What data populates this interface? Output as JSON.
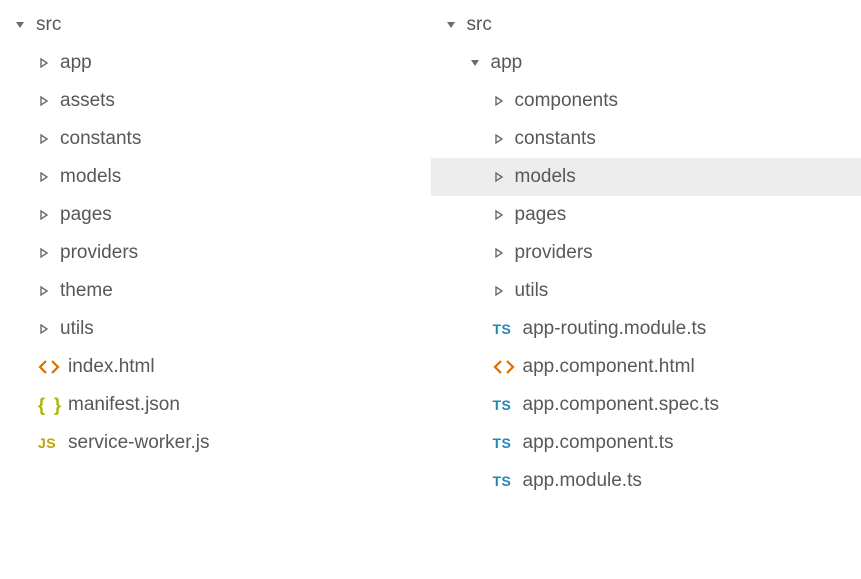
{
  "left": {
    "items": [
      {
        "label": "src",
        "type": "folder",
        "expanded": true,
        "depth": 0,
        "selected": false
      },
      {
        "label": "app",
        "type": "folder",
        "expanded": false,
        "depth": 1,
        "selected": false
      },
      {
        "label": "assets",
        "type": "folder",
        "expanded": false,
        "depth": 1,
        "selected": false
      },
      {
        "label": "constants",
        "type": "folder",
        "expanded": false,
        "depth": 1,
        "selected": false
      },
      {
        "label": "models",
        "type": "folder",
        "expanded": false,
        "depth": 1,
        "selected": false
      },
      {
        "label": "pages",
        "type": "folder",
        "expanded": false,
        "depth": 1,
        "selected": false
      },
      {
        "label": "providers",
        "type": "folder",
        "expanded": false,
        "depth": 1,
        "selected": false
      },
      {
        "label": "theme",
        "type": "folder",
        "expanded": false,
        "depth": 1,
        "selected": false
      },
      {
        "label": "utils",
        "type": "folder",
        "expanded": false,
        "depth": 1,
        "selected": false
      },
      {
        "label": "index.html",
        "type": "file",
        "icon": "html",
        "depth": 1,
        "selected": false
      },
      {
        "label": "manifest.json",
        "type": "file",
        "icon": "json",
        "depth": 1,
        "selected": false
      },
      {
        "label": "service-worker.js",
        "type": "file",
        "icon": "js",
        "depth": 1,
        "selected": false
      }
    ]
  },
  "right": {
    "items": [
      {
        "label": "src",
        "type": "folder",
        "expanded": true,
        "depth": 0,
        "selected": false
      },
      {
        "label": "app",
        "type": "folder",
        "expanded": true,
        "depth": 1,
        "selected": false
      },
      {
        "label": "components",
        "type": "folder",
        "expanded": false,
        "depth": 2,
        "selected": false
      },
      {
        "label": "constants",
        "type": "folder",
        "expanded": false,
        "depth": 2,
        "selected": false
      },
      {
        "label": "models",
        "type": "folder",
        "expanded": false,
        "depth": 2,
        "selected": true
      },
      {
        "label": "pages",
        "type": "folder",
        "expanded": false,
        "depth": 2,
        "selected": false
      },
      {
        "label": "providers",
        "type": "folder",
        "expanded": false,
        "depth": 2,
        "selected": false
      },
      {
        "label": "utils",
        "type": "folder",
        "expanded": false,
        "depth": 2,
        "selected": false
      },
      {
        "label": "app-routing.module.ts",
        "type": "file",
        "icon": "ts",
        "depth": 2,
        "selected": false
      },
      {
        "label": "app.component.html",
        "type": "file",
        "icon": "html",
        "depth": 2,
        "selected": false
      },
      {
        "label": "app.component.spec.ts",
        "type": "file",
        "icon": "ts",
        "depth": 2,
        "selected": false
      },
      {
        "label": "app.component.ts",
        "type": "file",
        "icon": "ts",
        "depth": 2,
        "selected": false
      },
      {
        "label": "app.module.ts",
        "type": "file",
        "icon": "ts",
        "depth": 2,
        "selected": false
      }
    ]
  },
  "icons": {
    "ts": "TS",
    "js": "JS",
    "html": "<>",
    "json": "{ }"
  }
}
